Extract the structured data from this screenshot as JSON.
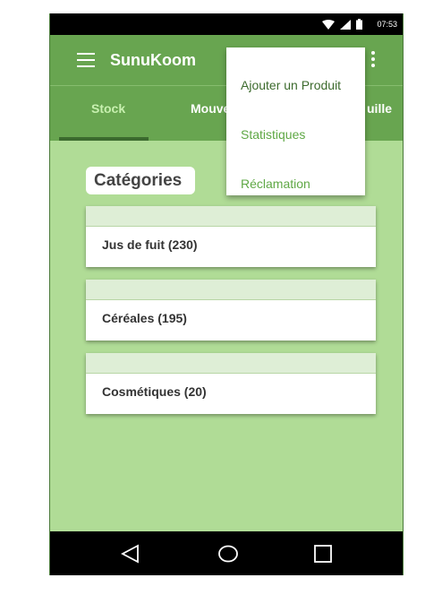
{
  "status_bar": {
    "time": "07:53"
  },
  "app": {
    "title": "SunuKoom"
  },
  "tabs": [
    {
      "label": "Stock"
    },
    {
      "label": "Mouve"
    },
    {
      "label": "uille"
    }
  ],
  "content": {
    "section_title": "Catégories",
    "categories": [
      {
        "label": "Jus de fuit (230)"
      },
      {
        "label": "Céréales (195)"
      },
      {
        "label": "Cosmétiques (20)"
      }
    ]
  },
  "menu": {
    "items": [
      {
        "label": "Ajouter un Produit"
      },
      {
        "label": "Statistiques"
      },
      {
        "label": "Réclamation"
      }
    ]
  },
  "colors": {
    "primary": "#68a550",
    "background": "#b0dc96",
    "menu_text_dark": "#3d6b2e",
    "menu_text_light": "#5fa845"
  },
  "icons": [
    "wifi-icon",
    "signal-icon",
    "battery-icon",
    "hamburger-menu-icon",
    "overflow-menu-icon",
    "back-icon",
    "home-icon",
    "recents-icon"
  ]
}
